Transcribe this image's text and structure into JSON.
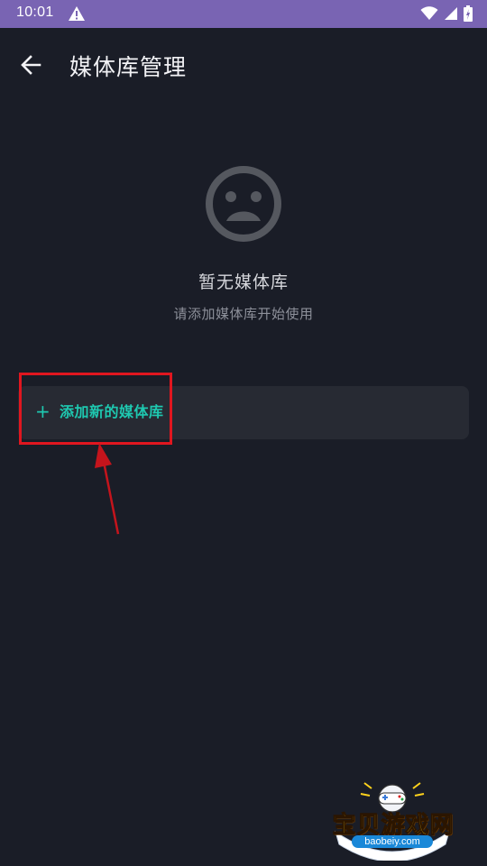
{
  "status_bar": {
    "time": "10:01",
    "icons": [
      "warning-icon",
      "wifi-icon",
      "signal-icon",
      "battery-icon"
    ],
    "background": "#7964b3"
  },
  "header": {
    "title": "媒体库管理",
    "back_icon": "arrow-left-icon"
  },
  "empty_state": {
    "icon": "sad-face-icon",
    "title": "暂无媒体库",
    "subtitle": "请添加媒体库开始使用"
  },
  "add_library": {
    "icon": "plus-icon",
    "plus": "+",
    "label": "添加新的媒体库",
    "accent": "#1ec8b0"
  },
  "annotation": {
    "highlight_color": "#e0161f",
    "arrow_color": "#c4141c"
  },
  "watermark": {
    "text": "宝贝游戏网",
    "url": "baobeiy.com"
  },
  "colors": {
    "background": "#1a1d27",
    "card": "#272a33"
  }
}
